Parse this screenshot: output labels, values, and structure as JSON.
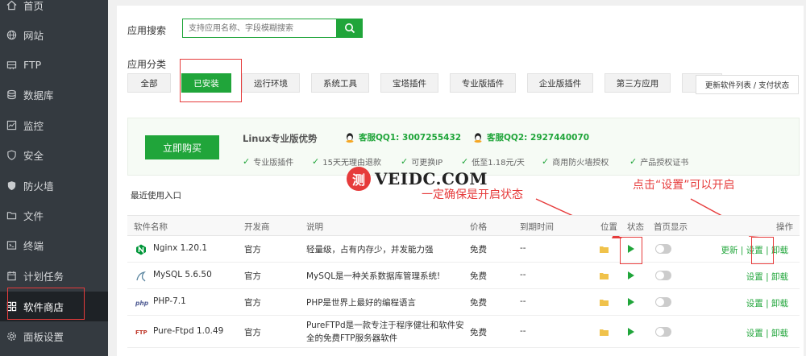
{
  "sidebar": {
    "items": [
      {
        "label": "首页",
        "icon": "home-icon"
      },
      {
        "label": "网站",
        "icon": "globe-icon"
      },
      {
        "label": "FTP",
        "icon": "ftp-icon"
      },
      {
        "label": "数据库",
        "icon": "database-icon"
      },
      {
        "label": "监控",
        "icon": "monitor-icon"
      },
      {
        "label": "安全",
        "icon": "shield-icon"
      },
      {
        "label": "防火墙",
        "icon": "firewall-icon"
      },
      {
        "label": "文件",
        "icon": "folder-icon"
      },
      {
        "label": "终端",
        "icon": "terminal-icon"
      },
      {
        "label": "计划任务",
        "icon": "clock-icon"
      },
      {
        "label": "软件商店",
        "icon": "grid-icon"
      },
      {
        "label": "面板设置",
        "icon": "gear-icon"
      }
    ]
  },
  "search": {
    "label": "应用搜索",
    "placeholder": "支持应用名称、字段模糊搜索"
  },
  "categories": {
    "label": "应用分类",
    "tabs": [
      "全部",
      "已安装",
      "运行环境",
      "系统工具",
      "宝塔插件",
      "专业版插件",
      "企业版插件",
      "第三方应用"
    ],
    "update_link": "更新软件列表 / 支付状态"
  },
  "pro": {
    "buy_label": "立即购买",
    "title": "Linux专业版优势",
    "qq1": "客服QQ1: 3007255432",
    "qq2": "客服QQ2: 2927440070",
    "features": [
      "专业版插件",
      "15天无理由退款",
      "可更换IP",
      "低至1.18元/天",
      "商用防火墙授权",
      "产品授权证书"
    ]
  },
  "watermark": {
    "logo": "测",
    "text": "VEIDC.COM"
  },
  "annotations": {
    "left": "一定确保是开启状态",
    "right": "点击“设置”可以开启"
  },
  "recent_label": "最近使用入口",
  "table": {
    "headers": [
      "软件名称",
      "开发商",
      "说明",
      "价格",
      "到期时间",
      "位置",
      "状态",
      "首页显示",
      "操作"
    ],
    "rows": [
      {
        "name": "Nginx 1.20.1",
        "icon": "nginx-icon",
        "vendor": "官方",
        "desc": "轻量级，占有内存少，并发能力强",
        "price": "免费",
        "expire": "--",
        "ops": [
          "更新",
          "设置",
          "卸载"
        ]
      },
      {
        "name": "MySQL 5.6.50",
        "icon": "mysql-icon",
        "vendor": "官方",
        "desc": "MySQL是一种关系数据库管理系统!",
        "price": "免费",
        "expire": "--",
        "ops": [
          "设置",
          "卸载"
        ]
      },
      {
        "name": "PHP-7.1",
        "icon": "php-icon",
        "vendor": "官方",
        "desc": "PHP是世界上最好的编程语言",
        "price": "免费",
        "expire": "--",
        "ops": [
          "设置",
          "卸载"
        ]
      },
      {
        "name": "Pure-Ftpd 1.0.49",
        "icon": "ftpd-icon",
        "vendor": "官方",
        "desc": "PureFTPd是一款专注于程序健壮和软件安",
        "desc2": "全的免费FTP服务器软件",
        "price": "免费",
        "expire": "--",
        "ops": [
          "设置",
          "卸载"
        ]
      }
    ]
  },
  "colors": {
    "accent": "#20a53a",
    "sidebar": "#343a40",
    "annotation": "#e63b3b"
  }
}
